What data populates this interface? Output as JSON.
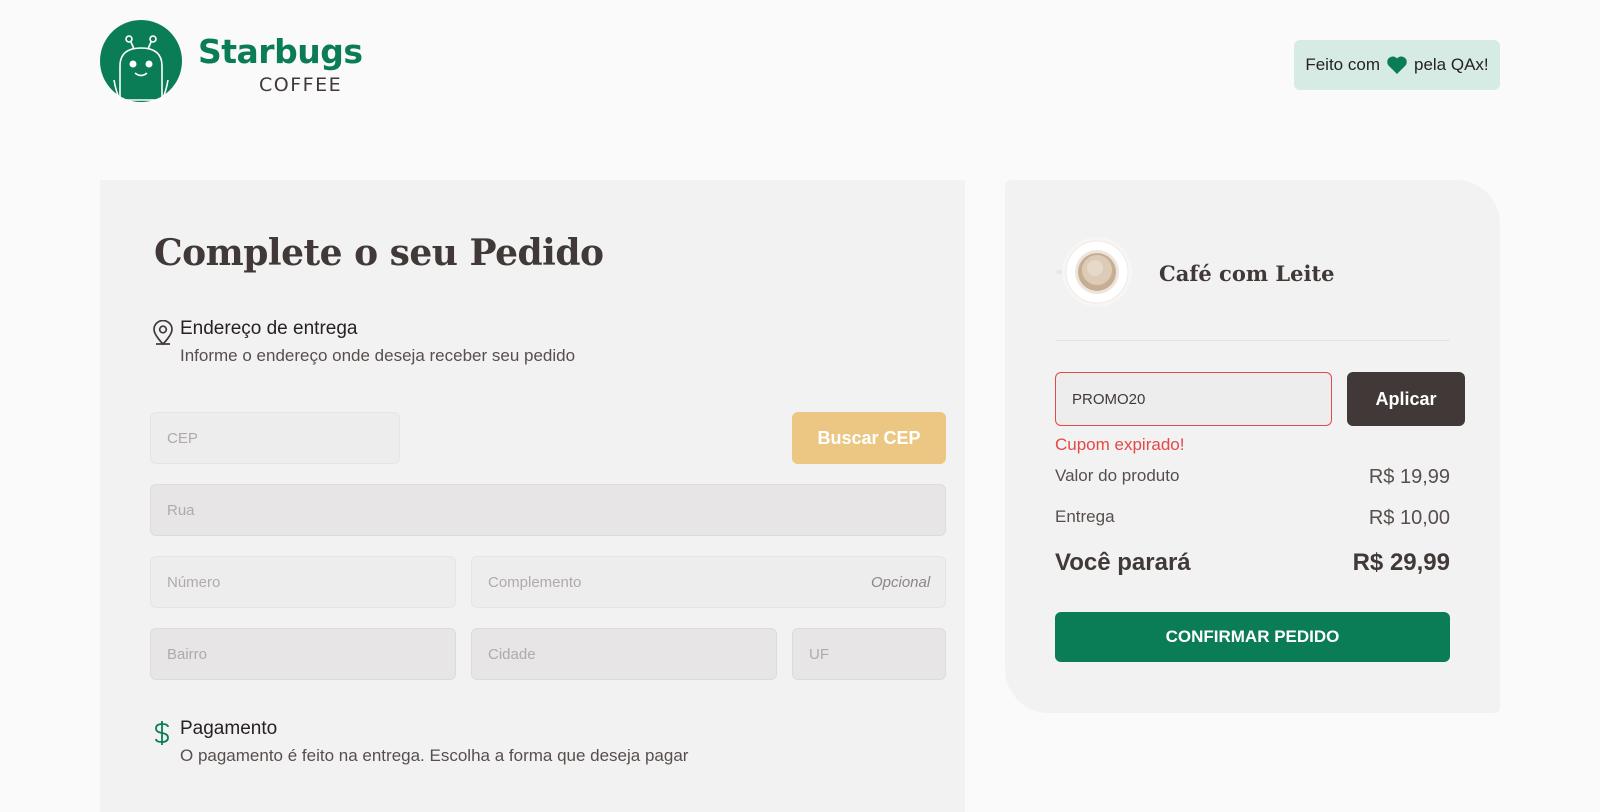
{
  "header": {
    "logo_title": "Starbugs",
    "logo_sub": "COFFEE",
    "made_with_prefix": "Feito com",
    "made_with_suffix": "pela QAx!",
    "icons": {
      "logo": "robot-mascot-icon",
      "heart": "heart-icon"
    }
  },
  "checkout": {
    "title": "Complete o seu Pedido",
    "address_section": {
      "title": "Endereço de entrega",
      "subtitle": "Informe o endereço onde deseja receber seu pedido",
      "icon": "map-pin-icon"
    },
    "fields": {
      "cep": {
        "placeholder": "CEP",
        "value": ""
      },
      "rua": {
        "placeholder": "Rua",
        "value": ""
      },
      "numero": {
        "placeholder": "Número",
        "value": ""
      },
      "complemento": {
        "placeholder": "Complemento",
        "value": "",
        "optional_label": "Opcional"
      },
      "bairro": {
        "placeholder": "Bairro",
        "value": ""
      },
      "cidade": {
        "placeholder": "Cidade",
        "value": ""
      },
      "uf": {
        "placeholder": "UF",
        "value": ""
      }
    },
    "buscar_cep_label": "Buscar CEP",
    "payment_section": {
      "title": "Pagamento",
      "subtitle": "O pagamento é feito na entrega. Escolha a forma que deseja pagar",
      "icon": "dollar-icon"
    }
  },
  "summary": {
    "product": {
      "name": "Café com Leite",
      "image": "coffee-cup-image"
    },
    "coupon": {
      "value": "PROMO20",
      "apply_label": "Aplicar",
      "error": "Cupom expirado!"
    },
    "lines": [
      {
        "label": "Valor do produto",
        "value": "R$ 19,99"
      },
      {
        "label": "Entrega",
        "value": "R$ 10,00"
      }
    ],
    "total": {
      "label": "Você parará",
      "value": "R$ 29,99"
    },
    "confirm_label": "CONFIRMAR PEDIDO"
  },
  "colors": {
    "brand_green": "#0a7c56",
    "brown": "#403937",
    "cep_button": "#ebc783",
    "error": "#e44848",
    "badge_bg": "#d6ebe3"
  }
}
